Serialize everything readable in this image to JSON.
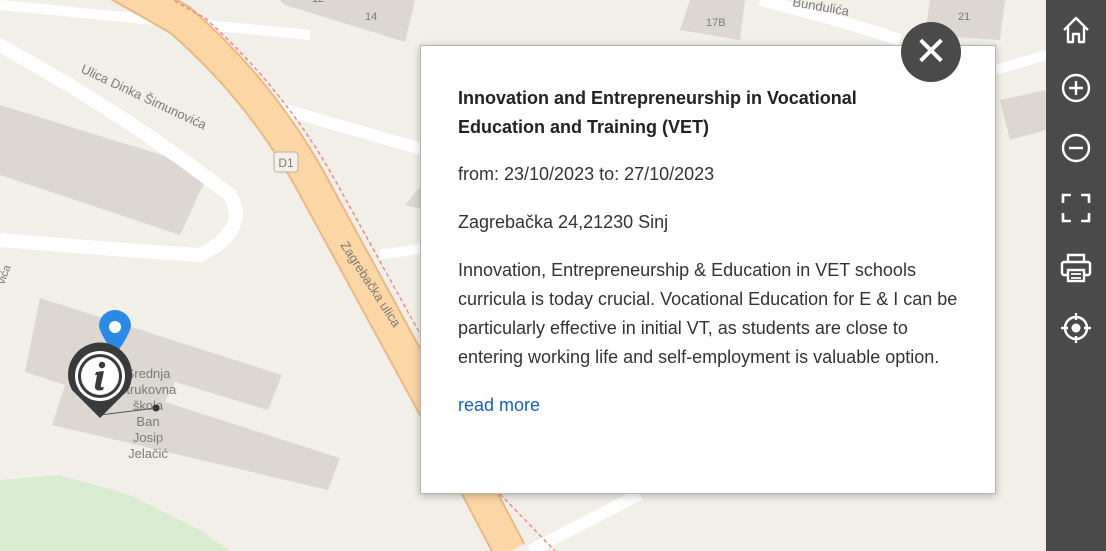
{
  "map": {
    "street_labels": {
      "dinka": "Ulica Dinka Šimunovića",
      "zagrebacka": "Zagrebačka ulica",
      "bundulica": "Bundulića",
      "edge": "vića",
      "road_code": "D1"
    },
    "house_numbers": [
      "14",
      "17B",
      "21",
      "12"
    ],
    "poi_label_lines": [
      "Srednja",
      "strukovna",
      "škola",
      "Ban",
      "Josip",
      "Jelačić"
    ],
    "marker_blue_icon": "location-pin-icon",
    "marker_info_icon": "info-pin-icon"
  },
  "popup": {
    "title": "Innovation and Entrepreneurship in Vocational Education and Training (VET)",
    "dates": "from: 23/10/2023 to: 27/10/2023",
    "address": "Zagrebačka 24,21230 Sinj",
    "description": "Innovation, Entrepreneurship & Education in VET schools curricula is today crucial. Vocational Education for E & I can be particularly effective in initial VT, as students are close to entering working life and self-employment is valuable option.",
    "read_more": "read more",
    "close_icon": "close-icon"
  },
  "toolbar": {
    "items": [
      {
        "icon": "home-icon"
      },
      {
        "icon": "zoom-in-icon"
      },
      {
        "icon": "zoom-out-icon"
      },
      {
        "icon": "fullscreen-icon"
      },
      {
        "icon": "print-icon"
      },
      {
        "icon": "locate-icon"
      }
    ],
    "color": "#4a4a4a"
  },
  "colors": {
    "map_background": "#f2efe9",
    "road_main": "#fcd6a4",
    "building": "#dcd7d1",
    "marker_blue": "#2b8ae6",
    "link": "#1a5fb4"
  }
}
